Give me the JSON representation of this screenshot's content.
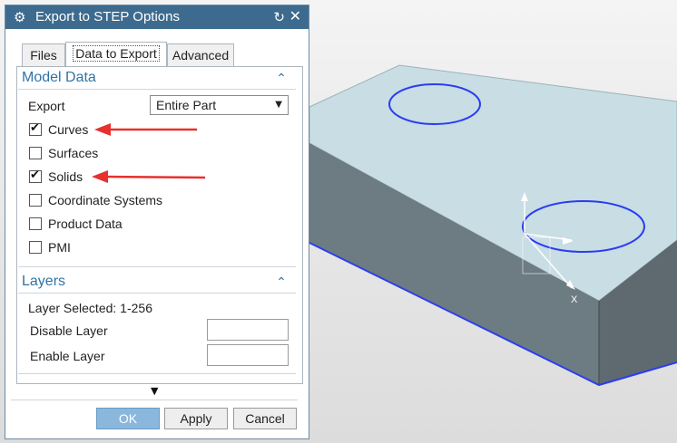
{
  "dialog": {
    "title": "Export to STEP Options",
    "tabs": [
      {
        "label": "Files"
      },
      {
        "label": "Data to Export"
      },
      {
        "label": "Advanced"
      }
    ]
  },
  "model_data": {
    "header": "Model Data",
    "export_label": "Export",
    "export_value": "Entire Part",
    "options": [
      {
        "label": "Curves",
        "checked": true
      },
      {
        "label": "Surfaces",
        "checked": false
      },
      {
        "label": "Solids",
        "checked": true
      },
      {
        "label": "Coordinate Systems",
        "checked": false
      },
      {
        "label": "Product Data",
        "checked": false
      },
      {
        "label": "PMI",
        "checked": false
      }
    ]
  },
  "layers": {
    "header": "Layers",
    "selected": "Layer Selected: 1-256",
    "disable_label": "Disable Layer",
    "enable_label": "Enable Layer",
    "disable_value": "",
    "enable_value": ""
  },
  "buttons": {
    "ok": "OK",
    "apply": "Apply",
    "cancel": "Cancel"
  },
  "viewport": {
    "axis_label": "X"
  },
  "colors": {
    "title_bar": "#3d6b8f",
    "accent": "#2f74a6",
    "ok_button": "#8ab7dc",
    "annotation_arrow": "#e5312f",
    "edge_highlight": "#2a3df0"
  }
}
